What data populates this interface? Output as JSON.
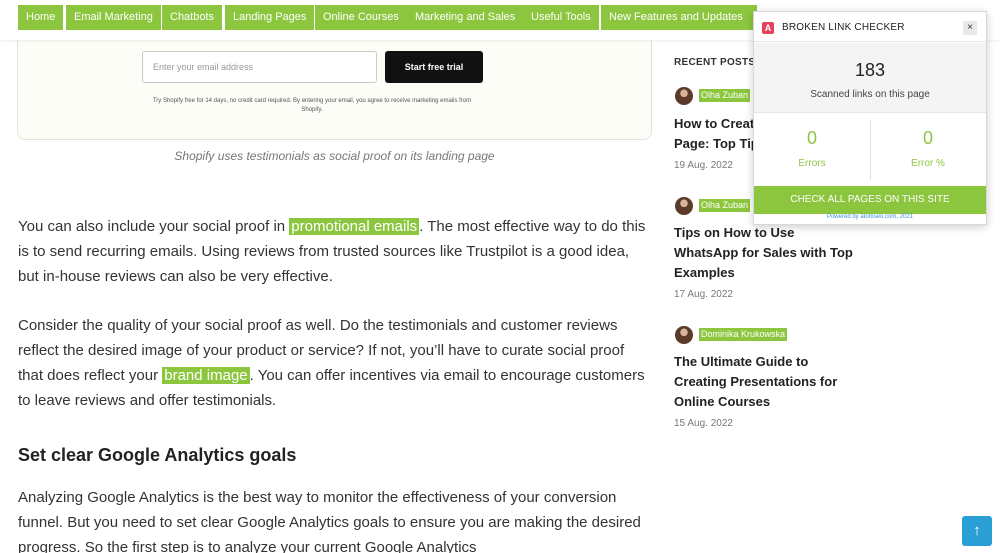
{
  "nav": {
    "items": [
      "Home",
      "Email Marketing",
      "Chatbots",
      "Landing Pages",
      "Online Courses",
      "Marketing and Sales",
      "Useful Tools",
      "New Features and Updates"
    ]
  },
  "signup": {
    "email_placeholder": "Enter your email address",
    "trial_button": "Start free trial",
    "disclaimer": "Try Shopify free for 14 days, no credit card required. By entering your email, you agree to receive marketing emails from Shopify."
  },
  "caption": "Shopify uses testimonials as social proof on its landing page",
  "article": {
    "p1_before": "You can also include your social proof in ",
    "p1_link": "promotional emails",
    "p1_after": ". The most effective way to do this is to send recurring emails. Using reviews from trusted sources like Trustpilot is a good idea, but in-house reviews can also be very effective.",
    "p2_before": "Consider the quality of your social proof as well. Do the testimonials and customer reviews reflect the desired image of your product or service? If not, you’ll have to curate social proof that does reflect your ",
    "p2_link": "brand image",
    "p2_after": ". You can offer incentives via email to encourage customers to leave reviews and offer testimonials.",
    "heading": "Set clear Google Analytics goals",
    "p3": "Analyzing Google Analytics is the best way to monitor the effectiveness of your conversion funnel. But you need to set clear Google Analytics goals to ensure you are making the desired progress. So the first step is to analyze your current Google Analytics"
  },
  "sidebar": {
    "title": "RECENT POSTS",
    "posts": [
      {
        "author": "Olha Zuban",
        "title": "How to Create a Landing Page: Top Tips",
        "date": "19 Aug. 2022"
      },
      {
        "author": "Olha Zuban",
        "title": "Tips on How to Use WhatsApp for Sales with Top Examples",
        "date": "17 Aug. 2022"
      },
      {
        "author": "Dominika Krukowska",
        "title": "The Ultimate Guide to Creating Presentations for Online Courses",
        "date": "15 Aug. 2022"
      }
    ]
  },
  "checker": {
    "logo": "A",
    "title": "BROKEN LINK CHECKER",
    "close": "×",
    "scanned_count": "183",
    "scanned_label": "Scanned links on this page",
    "errors_value": "0",
    "errors_label": "Errors",
    "error_pct_value": "0",
    "error_pct_label": "Error %",
    "check_all": "CHECK ALL PAGES ON THIS SITE",
    "powered": "Powered by atomseo.com, 2021"
  },
  "scroll_top_icon": "↑",
  "colors": {
    "accent": "#8cc63f",
    "checker_logo": "#e8415d",
    "scroll_button": "#2a9fd6"
  }
}
